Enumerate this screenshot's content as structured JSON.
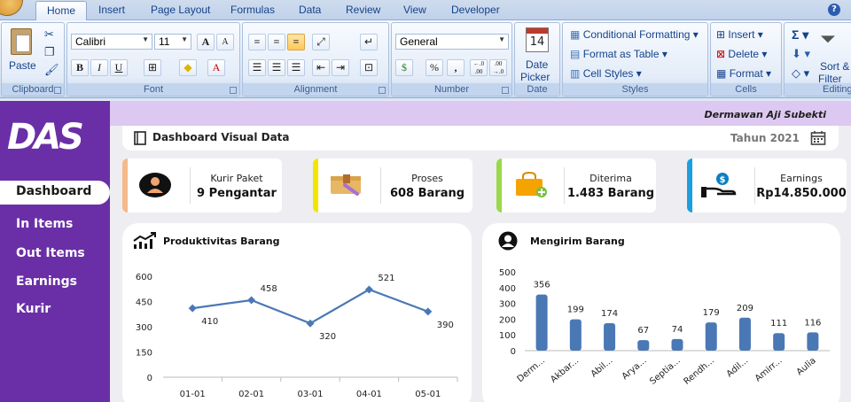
{
  "ribbon": {
    "tabs": [
      "Home",
      "Insert",
      "Page Layout",
      "Formulas",
      "Data",
      "Review",
      "View",
      "Developer"
    ],
    "active_tab": "Home",
    "clipboard": {
      "paste": "Paste",
      "label": "Clipboard"
    },
    "font": {
      "name": "Calibri",
      "size": "11",
      "grow": "A",
      "shrink": "A",
      "bold": "B",
      "italic": "I",
      "underline": "U",
      "label": "Font"
    },
    "alignment": {
      "label": "Alignment"
    },
    "number": {
      "format": "General",
      "percent": "%",
      "comma": ",",
      "inc": "←.0 .00",
      "dec": ".00 →.0",
      "label": "Number"
    },
    "date": {
      "day": "14",
      "picker_line1": "Date",
      "picker_line2": "Picker",
      "label": "Date"
    },
    "styles": {
      "conditional": "Conditional Formatting",
      "table": "Format as Table",
      "cell": "Cell Styles",
      "label": "Styles"
    },
    "cells": {
      "insert": "Insert",
      "delete": "Delete",
      "format": "Format",
      "label": "Cells"
    },
    "editing": {
      "sort_line1": "Sort &",
      "sort_line2": "Filter",
      "label": "Editing"
    }
  },
  "sidebar": {
    "logo": "DAS",
    "items": [
      {
        "label": "Dashboard",
        "active": true
      },
      {
        "label": "In Items",
        "active": false
      },
      {
        "label": "Out Items",
        "active": false
      },
      {
        "label": "Earnings",
        "active": false
      },
      {
        "label": "Kurir",
        "active": false
      }
    ]
  },
  "header": {
    "author": "Dermawan Aji Subekti",
    "title": "Dashboard Visual Data",
    "year": "Tahun 2021"
  },
  "kpis": [
    {
      "label": "Kurir Paket",
      "value": "9 Pengantar",
      "color": "#f5b98a",
      "icon": "user-icon"
    },
    {
      "label": "Proses",
      "value": "608 Barang",
      "color": "#f2e600",
      "icon": "package-icon"
    },
    {
      "label": "Diterima",
      "value": "1.483 Barang",
      "color": "#9ad94a",
      "icon": "bag-add-icon"
    },
    {
      "label": "Earnings",
      "value": "Rp14.850.000",
      "color": "#1b9fe0",
      "icon": "money-hand-icon"
    }
  ],
  "panels": {
    "left_title": "Produktivitas Barang",
    "right_title": "Mengirim Barang"
  },
  "chart_data": [
    {
      "type": "line",
      "title": "Produktivitas Barang",
      "categories": [
        "01-01",
        "02-01",
        "03-01",
        "04-01",
        "05-01"
      ],
      "values": [
        410,
        458,
        320,
        521,
        390
      ],
      "yticks": [
        0,
        150,
        300,
        450,
        600
      ],
      "ylim": [
        0,
        600
      ],
      "color": "#4a78b5",
      "grid": false
    },
    {
      "type": "bar",
      "title": "Mengirim Barang",
      "categories": [
        "Derm...",
        "Akbar...",
        "Abil...",
        "Arya...",
        "Septia...",
        "Rendh...",
        "Adil...",
        "Amirr...",
        "Aulia"
      ],
      "values": [
        356,
        199,
        174,
        67,
        74,
        179,
        209,
        111,
        116
      ],
      "yticks": [
        0,
        100,
        200,
        300,
        400,
        500
      ],
      "ylim": [
        0,
        500
      ],
      "color": "#4a78b5",
      "grid": false
    }
  ]
}
